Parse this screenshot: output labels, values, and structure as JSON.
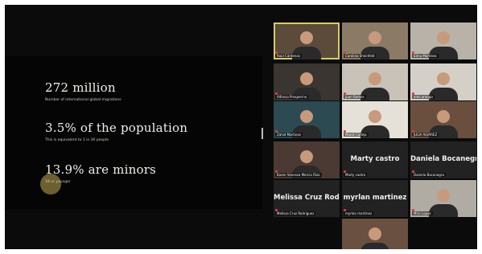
{
  "presentation": {
    "stats": [
      {
        "headline": "272 million",
        "detail": "Number of international global migrations"
      },
      {
        "headline": "3.5% of the population",
        "detail": "This is equivalent to 1 in 30 people"
      },
      {
        "headline": "13.9% are minors",
        "detail": "18 or younger"
      }
    ]
  },
  "participants": [
    {
      "name": "Raúl Cárdenas",
      "active": true,
      "bg": "#5c4a3a"
    },
    {
      "name": "Carolina Sheinfeld",
      "active": false,
      "bg": "#8b7a66"
    },
    {
      "name": "Edna Martinez",
      "active": false,
      "bg": "#b9b2a8"
    },
    {
      "name": "Alfonso Prosperino",
      "active": false,
      "bg": "#3a3530"
    },
    {
      "name": "Juan Ramos",
      "active": false,
      "bg": "#c8c2b8"
    },
    {
      "name": "eimi arango",
      "active": false,
      "bg": "#d4d0c8"
    },
    {
      "name": "Zahid Martinez",
      "active": false,
      "bg": "#2b4a52"
    },
    {
      "name": "Manik Calleja",
      "active": false,
      "bg": "#e6e1d8"
    },
    {
      "name": "JULIA ALVAREZ",
      "active": false,
      "bg": "#6a4f3e"
    },
    {
      "name": "Karen Vanessa Mercia Rizo",
      "active": false,
      "bg": "#4a3a33"
    },
    {
      "name": "Marty castro",
      "display": "Marty castro",
      "active": false,
      "bg": "#222222"
    },
    {
      "name": "Daniela Bocanegra",
      "display": "Daniela Bocanegra",
      "active": false,
      "bg": "#222222"
    },
    {
      "name": "Melissa Cruz Rodriguez",
      "display": "Melissa Cruz Rod...",
      "active": false,
      "bg": "#222222"
    },
    {
      "name": "myrlan martinez",
      "display": "myrlan martinez",
      "active": false,
      "bg": "#222222"
    },
    {
      "name": "Mira Lopez",
      "active": false,
      "bg": "#b0aca4"
    },
    {
      "name": "",
      "active": false,
      "bg": "#6a5040"
    }
  ]
}
